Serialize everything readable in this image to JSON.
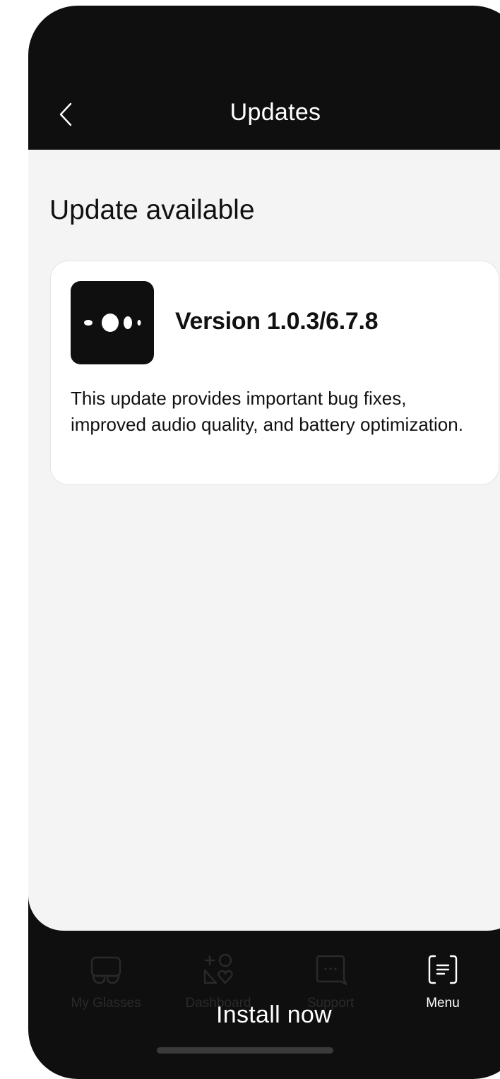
{
  "header": {
    "title": "Updates",
    "back_icon": "chevron-left-icon"
  },
  "main": {
    "section_title": "Update available",
    "card": {
      "app_icon": "device-logo-icon",
      "version": "Version 1.0.3/6.7.8",
      "description": "This update provides important bug fixes, improved audio quality, and battery optimization."
    },
    "install_label": "Install now"
  },
  "tabbar": {
    "items": [
      {
        "label": "My Glasses",
        "icon": "glasses-icon",
        "active": false
      },
      {
        "label": "Dashboard",
        "icon": "dashboard-icon",
        "active": false
      },
      {
        "label": "Support",
        "icon": "chat-bubble-icon",
        "active": false
      },
      {
        "label": "Menu",
        "icon": "menu-icon",
        "active": true
      }
    ]
  },
  "colors": {
    "background_dark": "#0f0f0f",
    "surface": "#f4f4f4",
    "card": "#ffffff",
    "text_primary": "#111111",
    "tab_inactive": "#2a2a2a",
    "tab_active": "#ffffff"
  }
}
